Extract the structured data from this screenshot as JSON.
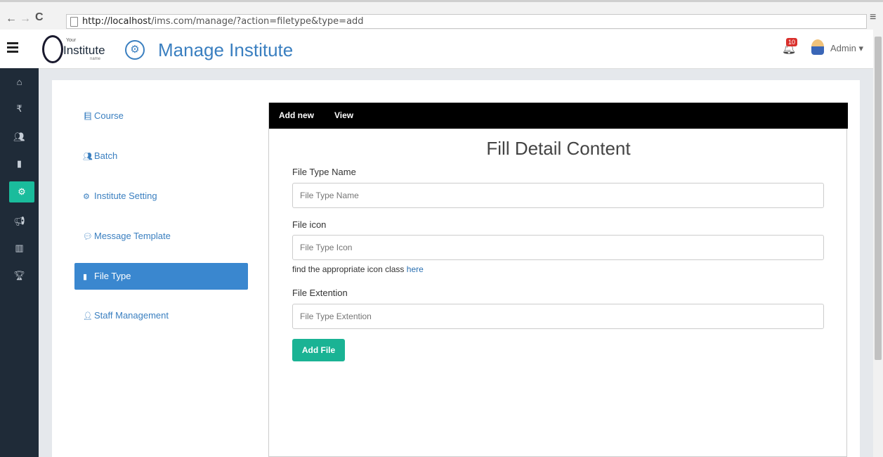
{
  "browser": {
    "back": "←",
    "forward": "→",
    "reload": "C",
    "url_host": "http://localhost",
    "url_path": "/ims.com/manage/?action=filetype&type=add",
    "menu": "≡"
  },
  "header": {
    "logo_your": "Your",
    "logo_institute": "Institute",
    "logo_name": "name",
    "title": "Manage Institute",
    "notification_count": "10",
    "user": "Admin ▾"
  },
  "sidebar_icons": [
    "home-icon",
    "rupee-icon",
    "users-icon",
    "file-icon",
    "cogs-icon",
    "bullhorn-icon",
    "chart-icon",
    "trophy-icon"
  ],
  "menu": [
    {
      "label": "Course",
      "icon": "book-icon"
    },
    {
      "label": "Batch",
      "icon": "users-icon"
    },
    {
      "label": "Institute Setting",
      "icon": "cogs-icon"
    },
    {
      "label": "Message Template",
      "icon": "comment-icon"
    },
    {
      "label": "File Type",
      "icon": "file-icon",
      "active": true
    },
    {
      "label": "Staff Management",
      "icon": "user-icon"
    }
  ],
  "tabs": {
    "add_new": "Add new",
    "view": "View"
  },
  "form": {
    "title": "Fill Detail Content",
    "name_label": "File Type Name",
    "name_placeholder": "File Type Name",
    "icon_label": "File icon",
    "icon_placeholder": "File Type Icon",
    "help_text": "find the appropriate icon class ",
    "help_link": "here",
    "ext_label": "File Extention",
    "ext_placeholder": "File Type Extention",
    "submit": "Add File"
  },
  "colors": {
    "accent": "#3a7fc0",
    "sidebar": "#1f2b38",
    "active_sidebar": "#1abc9c",
    "button": "#1ab394"
  }
}
